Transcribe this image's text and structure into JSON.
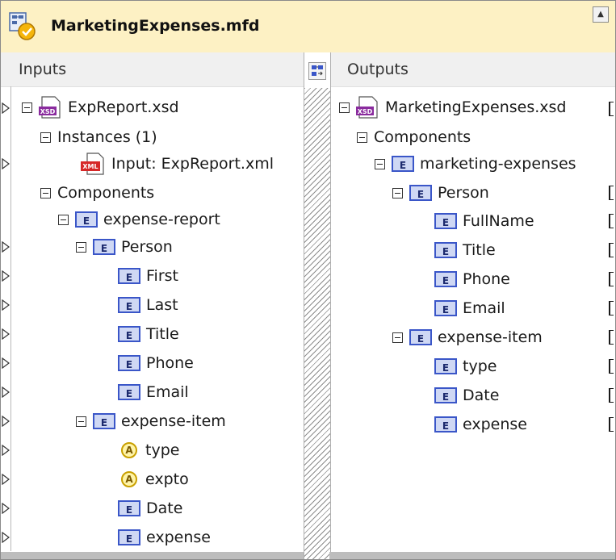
{
  "window": {
    "title": "MarketingExpenses.mfd"
  },
  "inputs": {
    "header": "Inputs",
    "schema": "ExpReport.xsd",
    "instances_label": "Instances (1)",
    "instance_file": "Input: ExpReport.xml",
    "components_label": "Components",
    "root": "expense-report",
    "person": "Person",
    "person_fields": [
      "First",
      "Last",
      "Title",
      "Phone",
      "Email"
    ],
    "expense_item": "expense-item",
    "attributes": [
      "type",
      "expto"
    ],
    "item_fields": [
      "Date",
      "expense"
    ]
  },
  "outputs": {
    "header": "Outputs",
    "schema": "MarketingExpenses.xsd",
    "components_label": "Components",
    "root": "marketing-expenses",
    "person": "Person",
    "person_fields": [
      "FullName",
      "Title",
      "Phone",
      "Email"
    ],
    "expense_item": "expense-item",
    "item_fields": [
      "type",
      "Date",
      "expense"
    ]
  },
  "icons": {
    "element_badge": "E",
    "attribute_badge": "A"
  }
}
